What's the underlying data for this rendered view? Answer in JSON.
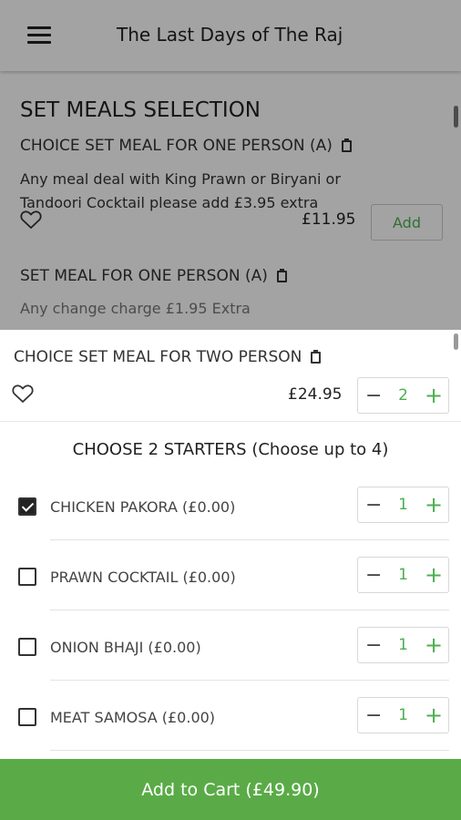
{
  "app_bar": {
    "title": "The Last Days of The Raj"
  },
  "background_menu": {
    "section_title": "SET MEALS SELECTION",
    "items": [
      {
        "name": "CHOICE SET MEAL FOR ONE PERSON (A)",
        "description": "Any meal deal with King Prawn or Biryani or Tandoori Cocktail please add £3.95 extra",
        "price": "£11.95",
        "add_label": "Add"
      },
      {
        "name": "SET MEAL FOR ONE PERSON (A)",
        "description": "Any change charge £1.95 Extra"
      }
    ]
  },
  "sheet": {
    "item_name": "CHOICE SET MEAL FOR TWO PERSON",
    "price": "£24.95",
    "quantity": "2",
    "starters_title": "CHOOSE 2 STARTERS (Choose up to 4)",
    "options": [
      {
        "label": "CHICKEN PAKORA (£0.00)",
        "checked": true,
        "quantity": "1"
      },
      {
        "label": "PRAWN COCKTAIL (£0.00)",
        "checked": false,
        "quantity": "1"
      },
      {
        "label": "ONION BHAJI (£0.00)",
        "checked": false,
        "quantity": "1"
      },
      {
        "label": "MEAT SAMOSA (£0.00)",
        "checked": false,
        "quantity": "1"
      }
    ],
    "minus_symbol": "−",
    "plus_symbol": "+"
  },
  "cta": {
    "label": "Add to Cart (£49.90)"
  },
  "colors": {
    "accent_green": "#5aab47",
    "overlay": "rgba(0,0,0,0.36)"
  }
}
